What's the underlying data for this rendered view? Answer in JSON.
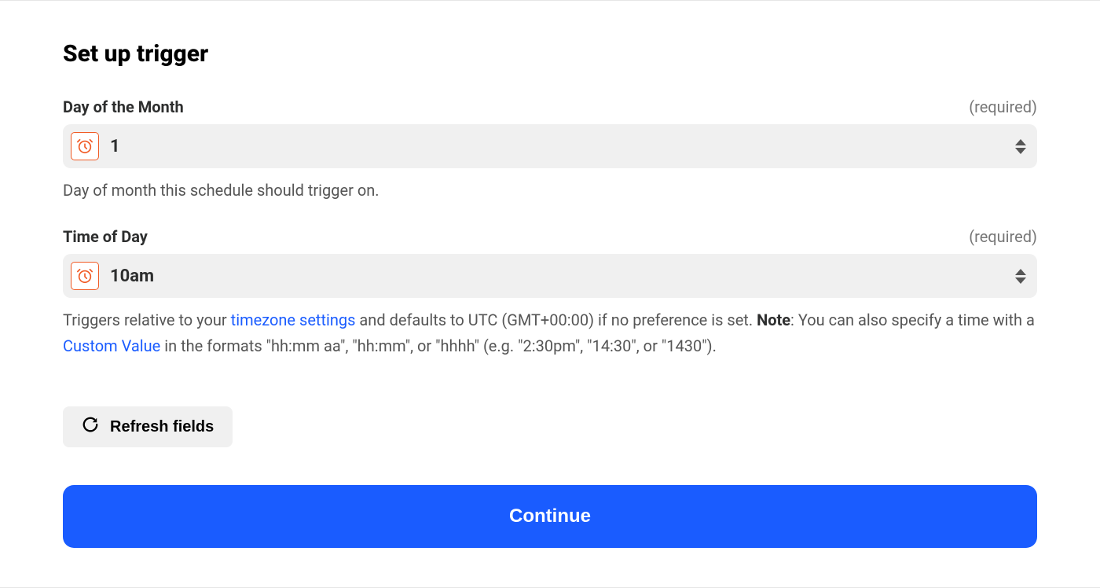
{
  "title": "Set up trigger",
  "fields": {
    "dayOfMonth": {
      "label": "Day of the Month",
      "required": "(required)",
      "value": "1",
      "helper": "Day of month this schedule should trigger on."
    },
    "timeOfDay": {
      "label": "Time of Day",
      "required": "(required)",
      "value": "10am",
      "helper_parts": {
        "prefix": "Triggers relative to your ",
        "link1": "timezone settings",
        "mid1": " and defaults to UTC (GMT+00:00) if no preference is set. ",
        "noteLabel": "Note",
        "mid2": ": You can also specify a time with a ",
        "link2": "Custom Value",
        "suffix": " in the formats \"hh:mm aa\", \"hh:mm\", or \"hhhh\" (e.g. \"2:30pm\", \"14:30\", or \"1430\")."
      }
    }
  },
  "buttons": {
    "refresh": "Refresh fields",
    "continue": "Continue"
  }
}
